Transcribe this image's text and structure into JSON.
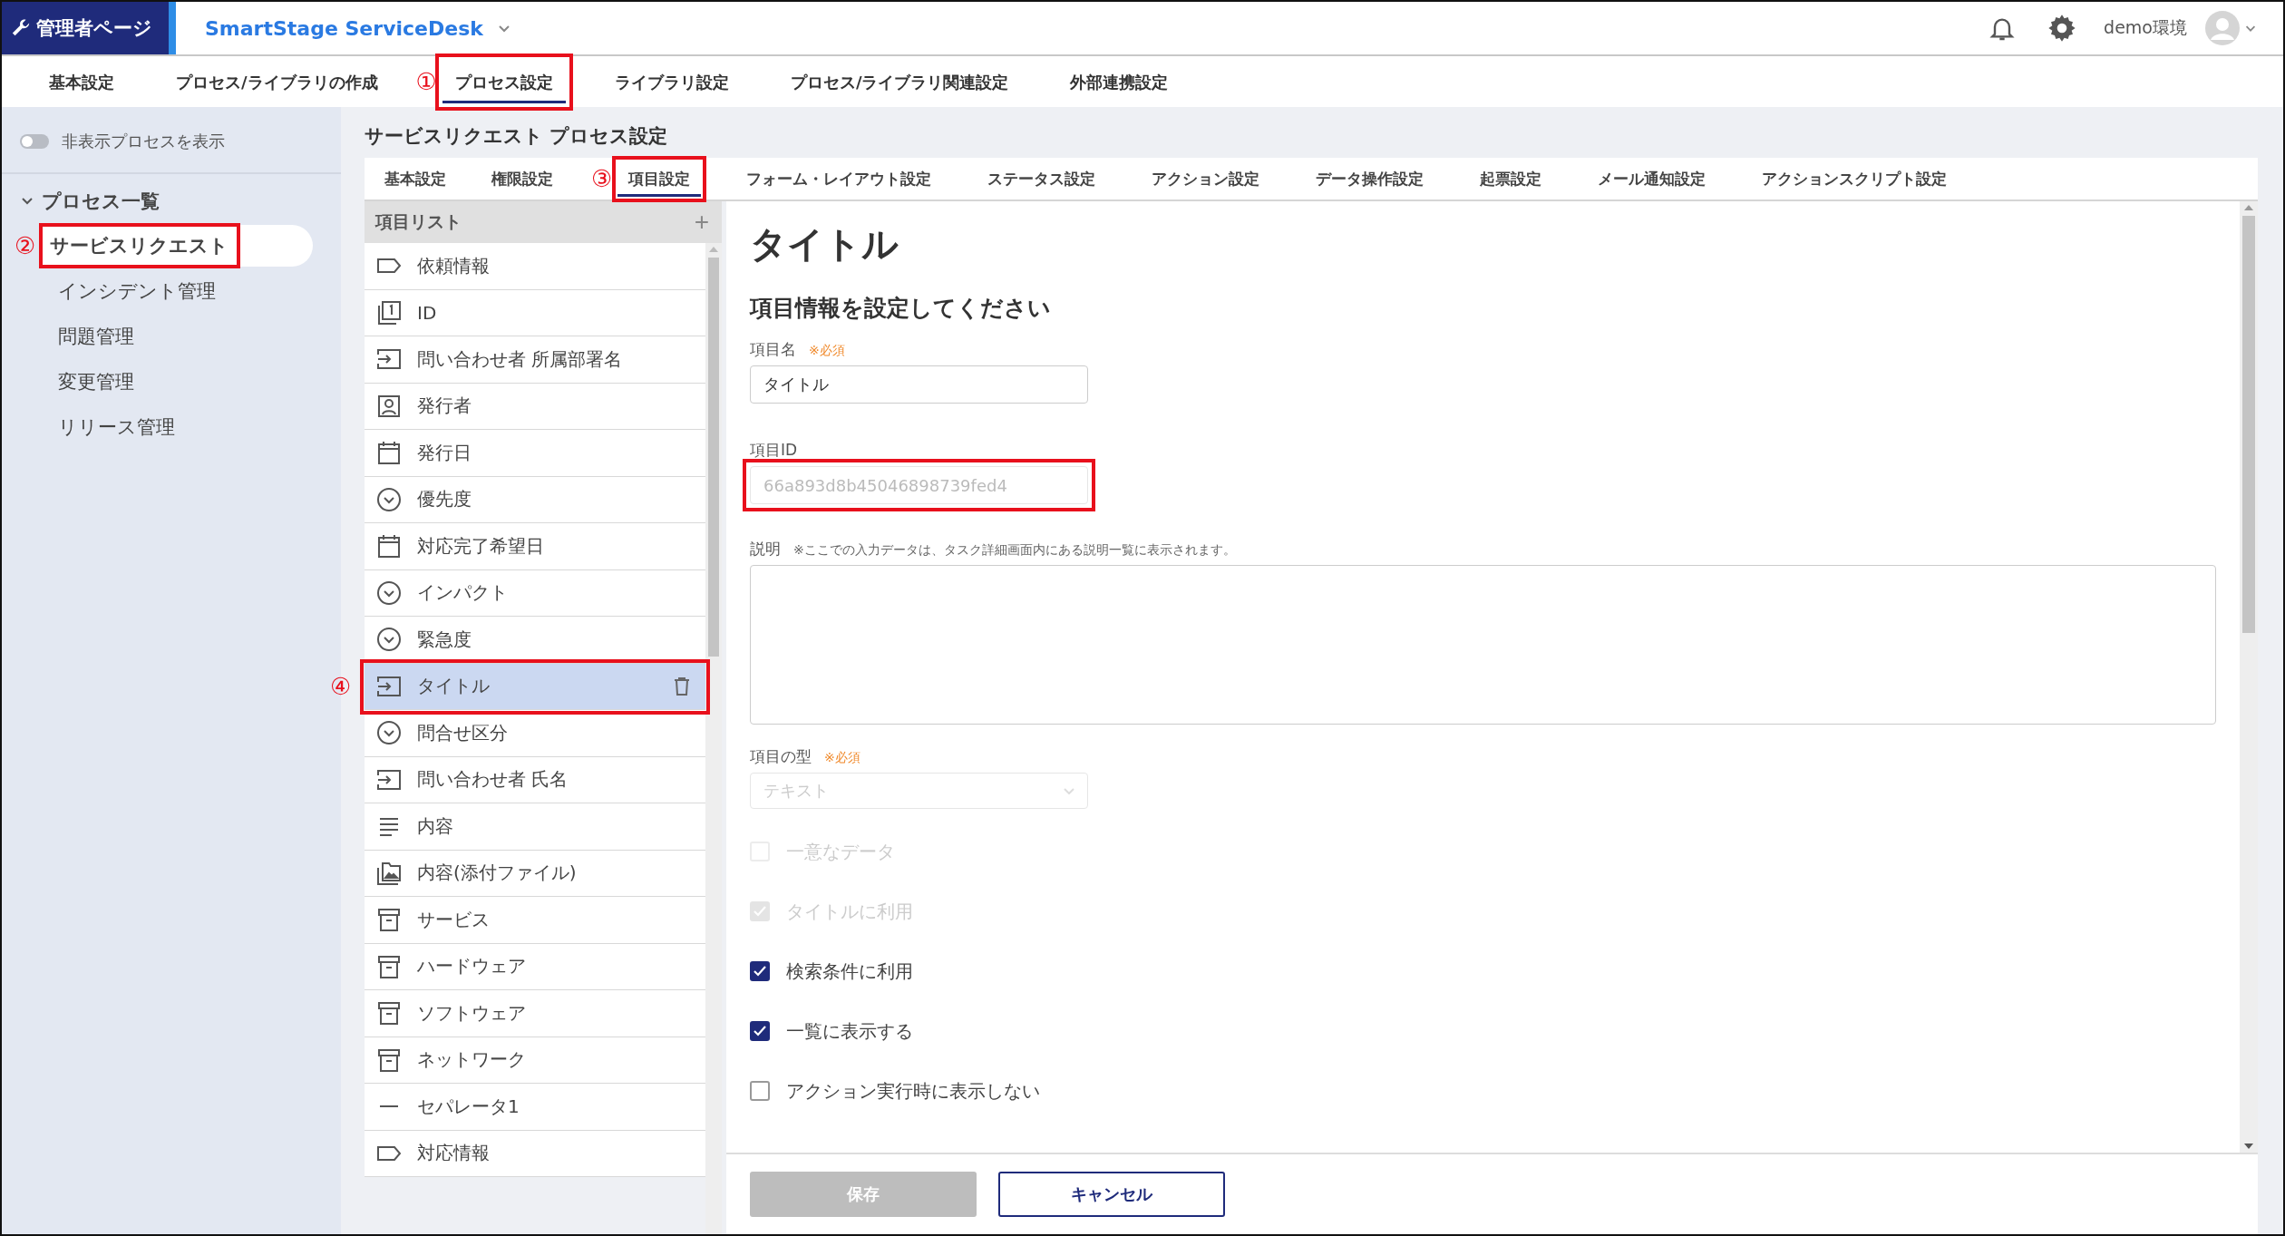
{
  "header": {
    "badge": "管理者ページ",
    "app_name": "SmartStage ServiceDesk",
    "user": "demo環境"
  },
  "main_tabs": [
    {
      "label": "基本設定",
      "selected": false
    },
    {
      "label": "プロセス/ライブラリの作成",
      "selected": false
    },
    {
      "label": "プロセス設定",
      "selected": true,
      "highlighted": true,
      "callout": "①"
    },
    {
      "label": "ライブラリ設定",
      "selected": false
    },
    {
      "label": "プロセス/ライブラリ関連設定",
      "selected": false
    },
    {
      "label": "外部連携設定",
      "selected": false
    }
  ],
  "sidebar": {
    "toggle": {
      "label": "非表示プロセスを表示",
      "on": false
    },
    "group": {
      "label": "プロセス一覧",
      "expanded": true,
      "items": [
        {
          "label": "サービスリクエスト",
          "selected": true,
          "highlighted": true,
          "callout": "②"
        },
        {
          "label": "インシデント管理",
          "selected": false
        },
        {
          "label": "問題管理",
          "selected": false
        },
        {
          "label": "変更管理",
          "selected": false
        },
        {
          "label": "リリース管理",
          "selected": false
        }
      ]
    }
  },
  "page_title": "サービスリクエスト プロセス設定",
  "sub_tabs": [
    {
      "label": "基本設定",
      "selected": false
    },
    {
      "label": "権限設定",
      "selected": false
    },
    {
      "label": "項目設定",
      "selected": true,
      "highlighted": true,
      "callout": "③"
    },
    {
      "label": "フォーム・レイアウト設定",
      "selected": false
    },
    {
      "label": "ステータス設定",
      "selected": false
    },
    {
      "label": "アクション設定",
      "selected": false
    },
    {
      "label": "データ操作設定",
      "selected": false
    },
    {
      "label": "起票設定",
      "selected": false
    },
    {
      "label": "メール通知設定",
      "selected": false
    },
    {
      "label": "アクションスクリプト設定",
      "selected": false
    }
  ],
  "item_list": {
    "title": "項目リスト",
    "add": "+",
    "items": [
      {
        "label": "依頼情報",
        "kind": "section",
        "selected": false
      },
      {
        "label": "ID",
        "kind": "id",
        "selected": false
      },
      {
        "label": "問い合わせ者 所属部署名",
        "kind": "input",
        "selected": false
      },
      {
        "label": "発行者",
        "kind": "person",
        "selected": false
      },
      {
        "label": "発行日",
        "kind": "date",
        "selected": false
      },
      {
        "label": "優先度",
        "kind": "select",
        "selected": false
      },
      {
        "label": "対応完了希望日",
        "kind": "date",
        "selected": false
      },
      {
        "label": "インパクト",
        "kind": "select",
        "selected": false
      },
      {
        "label": "緊急度",
        "kind": "select",
        "selected": false
      },
      {
        "label": "タイトル",
        "kind": "input",
        "selected": true,
        "highlighted": true,
        "callout": "④"
      },
      {
        "label": "問合せ区分",
        "kind": "select",
        "selected": false
      },
      {
        "label": "問い合わせ者 氏名",
        "kind": "input",
        "selected": false
      },
      {
        "label": "内容",
        "kind": "text",
        "selected": false
      },
      {
        "label": "内容(添付ファイル)",
        "kind": "file",
        "selected": false
      },
      {
        "label": "サービス",
        "kind": "master",
        "selected": false
      },
      {
        "label": "ハードウェア",
        "kind": "master",
        "selected": false
      },
      {
        "label": "ソフトウェア",
        "kind": "master",
        "selected": false
      },
      {
        "label": "ネットワーク",
        "kind": "master",
        "selected": false
      },
      {
        "label": "セパレータ1",
        "kind": "separator",
        "selected": false
      },
      {
        "label": "対応情報",
        "kind": "section",
        "selected": false
      }
    ]
  },
  "form": {
    "heading": "タイトル",
    "subheading": "項目情報を設定してください",
    "name_field": {
      "label": "項目名",
      "required": "※必須",
      "value": "タイトル"
    },
    "id_field": {
      "label": "項目ID",
      "value": "66a893d8b45046898739fed4",
      "disabled": true,
      "highlighted": true
    },
    "description_field": {
      "label": "説明",
      "note": "※ここでの入力データは、タスク詳細画面内にある説明一覧に表示されます。"
    },
    "type_field": {
      "label": "項目の型",
      "required": "※必須",
      "value": "テキスト",
      "disabled": true
    },
    "checkboxes": [
      {
        "label": "一意なデータ",
        "checked": false,
        "disabled": true
      },
      {
        "label": "タイトルに利用",
        "checked": true,
        "disabled": true
      },
      {
        "label": "検索条件に利用",
        "checked": true,
        "disabled": false
      },
      {
        "label": "一覧に表示する",
        "checked": true,
        "disabled": false
      },
      {
        "label": "アクション実行時に表示しない",
        "checked": false,
        "disabled": false
      }
    ]
  },
  "buttons": [
    {
      "label": "保存",
      "kind": "save",
      "disabled": true
    },
    {
      "label": "キャンセル",
      "kind": "cancel",
      "disabled": false
    }
  ]
}
